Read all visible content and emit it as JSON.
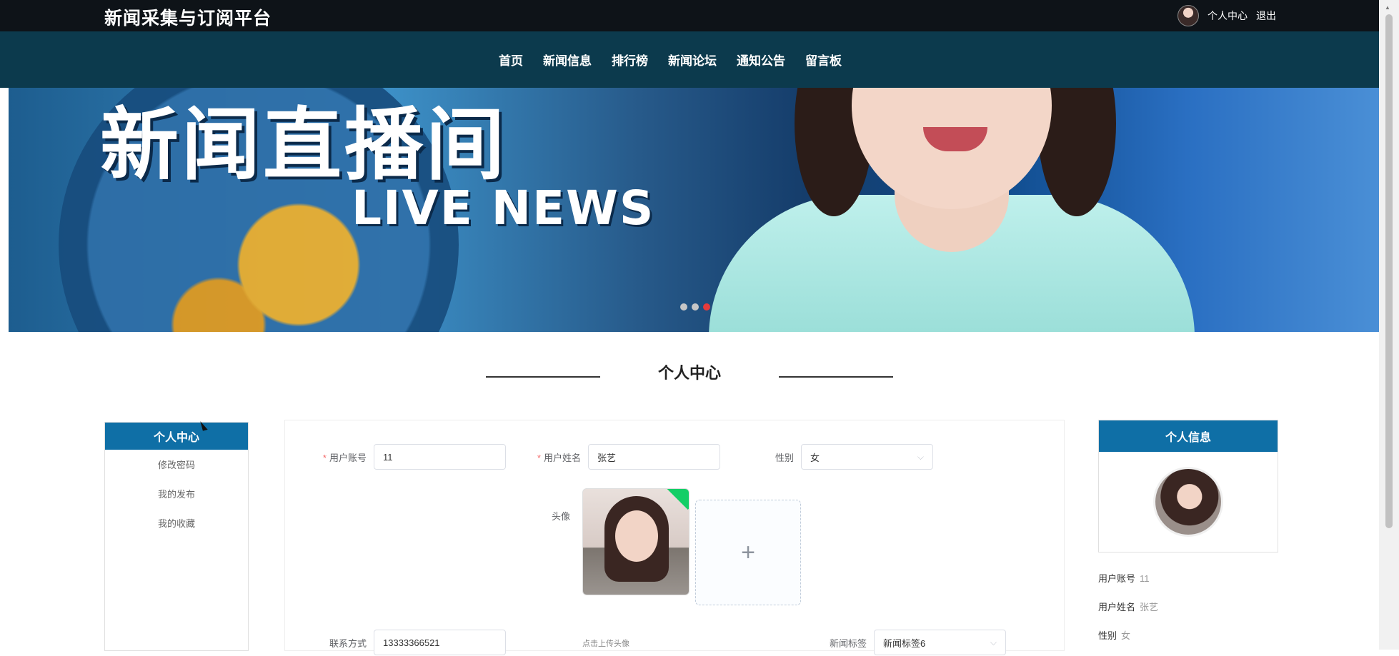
{
  "header": {
    "brand": "新闻采集与订阅平台",
    "user_center": "个人中心",
    "logout": "退出"
  },
  "nav": {
    "items": [
      "首页",
      "新闻信息",
      "排行榜",
      "新闻论坛",
      "通知公告",
      "留言板"
    ]
  },
  "banner": {
    "title": "新闻直播间",
    "subtitle": "LIVE NEWS",
    "slides_total": 3,
    "active_slide": 3
  },
  "section": {
    "title": "个人中心"
  },
  "sidebar": {
    "header": "个人中心",
    "items": [
      "修改密码",
      "我的发布",
      "我的收藏"
    ]
  },
  "form": {
    "account_label": "用户账号",
    "account_value": "11",
    "name_label": "用户姓名",
    "name_value": "张艺",
    "gender_label": "性别",
    "gender_value": "女",
    "avatar_label": "头像",
    "upload_hint": "点击上传头像",
    "phone_label": "联系方式",
    "phone_value": "13333366521",
    "tag_label": "新闻标签",
    "tag_value": "新闻标签6",
    "required_mark": "*"
  },
  "info": {
    "header": "个人信息",
    "account_label": "用户账号",
    "account_value": "11",
    "name_label": "用户姓名",
    "name_value": "张艺",
    "gender_label": "性别",
    "gender_value": "女"
  },
  "icons": {
    "upload": "+",
    "dropdown": "⌵"
  },
  "colors": {
    "topbar": "#0e1318",
    "navbar": "#0c3a4d",
    "accent": "#0f6fa6",
    "required": "#f56c6c",
    "active_dot": "#e63b3b"
  }
}
